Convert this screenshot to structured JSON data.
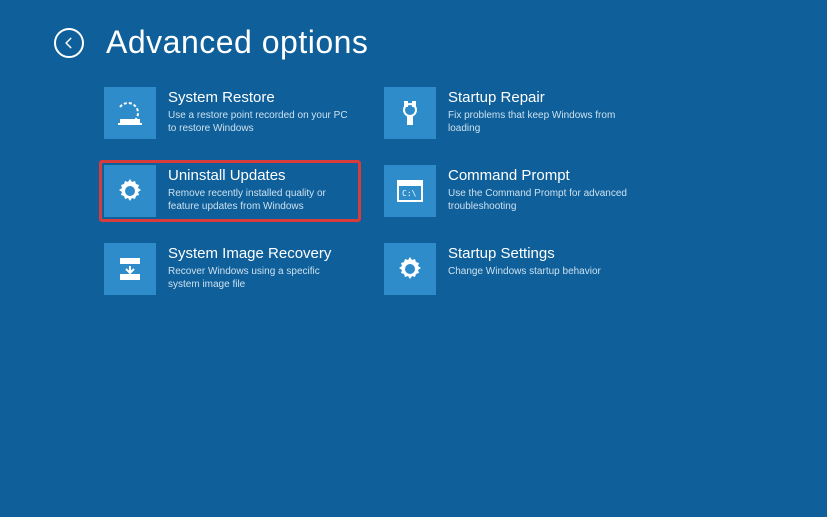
{
  "header": {
    "title": "Advanced options"
  },
  "options": [
    {
      "id": "system-restore",
      "title": "System Restore",
      "desc": "Use a restore point recorded on your PC to restore Windows",
      "icon": "restore",
      "highlighted": false
    },
    {
      "id": "startup-repair",
      "title": "Startup Repair",
      "desc": "Fix problems that keep Windows from loading",
      "icon": "wrench",
      "highlighted": false
    },
    {
      "id": "uninstall-updates",
      "title": "Uninstall Updates",
      "desc": "Remove recently installed quality or feature updates from Windows",
      "icon": "gear",
      "highlighted": true
    },
    {
      "id": "command-prompt",
      "title": "Command Prompt",
      "desc": "Use the Command Prompt for advanced troubleshooting",
      "icon": "terminal",
      "highlighted": false
    },
    {
      "id": "system-image-recovery",
      "title": "System Image Recovery",
      "desc": "Recover Windows using a specific system image file",
      "icon": "image-recovery",
      "highlighted": false
    },
    {
      "id": "startup-settings",
      "title": "Startup Settings",
      "desc": "Change Windows startup behavior",
      "icon": "gear",
      "highlighted": false
    }
  ]
}
